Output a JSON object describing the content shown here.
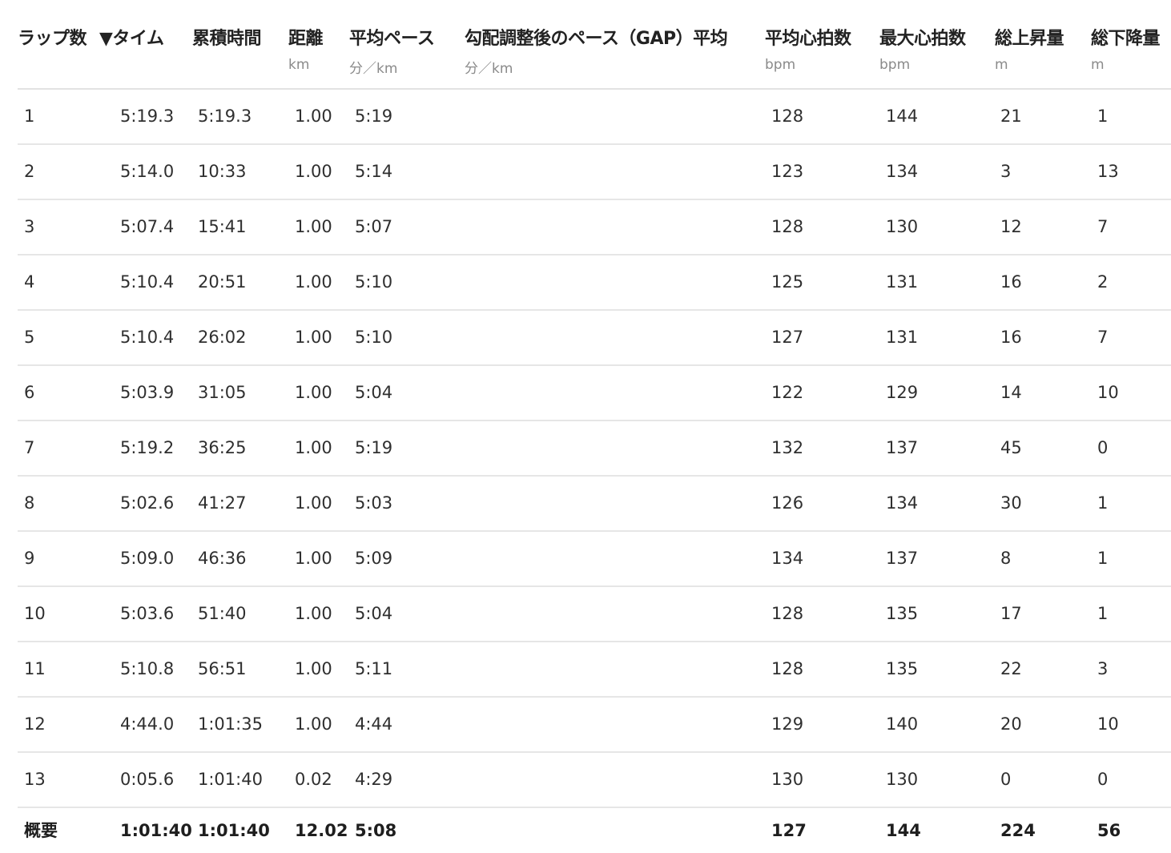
{
  "columns": [
    {
      "key": "lap",
      "title": "ラップ数",
      "unit": ""
    },
    {
      "key": "time",
      "title": "▼タイム",
      "unit": ""
    },
    {
      "key": "cumulative",
      "title": "累積時間",
      "unit": ""
    },
    {
      "key": "distance",
      "title": "距離",
      "unit": "km"
    },
    {
      "key": "pace",
      "title": "平均ペース",
      "unit": "分／km"
    },
    {
      "key": "gap",
      "title": "勾配調整後のペース（GAP）平均",
      "unit": "分／km"
    },
    {
      "key": "avg_hr",
      "title": "平均心拍数",
      "unit": "bpm"
    },
    {
      "key": "max_hr",
      "title": "最大心拍数",
      "unit": "bpm"
    },
    {
      "key": "ascent",
      "title": "総上昇量",
      "unit": "m"
    },
    {
      "key": "descent",
      "title": "総下降量",
      "unit": "m"
    }
  ],
  "rows": [
    [
      "1",
      "5:19.3",
      "5:19.3",
      "1.00",
      "5:19",
      "",
      "128",
      "144",
      "21",
      "1"
    ],
    [
      "2",
      "5:14.0",
      "10:33",
      "1.00",
      "5:14",
      "",
      "123",
      "134",
      "3",
      "13"
    ],
    [
      "3",
      "5:07.4",
      "15:41",
      "1.00",
      "5:07",
      "",
      "128",
      "130",
      "12",
      "7"
    ],
    [
      "4",
      "5:10.4",
      "20:51",
      "1.00",
      "5:10",
      "",
      "125",
      "131",
      "16",
      "2"
    ],
    [
      "5",
      "5:10.4",
      "26:02",
      "1.00",
      "5:10",
      "",
      "127",
      "131",
      "16",
      "7"
    ],
    [
      "6",
      "5:03.9",
      "31:05",
      "1.00",
      "5:04",
      "",
      "122",
      "129",
      "14",
      "10"
    ],
    [
      "7",
      "5:19.2",
      "36:25",
      "1.00",
      "5:19",
      "",
      "132",
      "137",
      "45",
      "0"
    ],
    [
      "8",
      "5:02.6",
      "41:27",
      "1.00",
      "5:03",
      "",
      "126",
      "134",
      "30",
      "1"
    ],
    [
      "9",
      "5:09.0",
      "46:36",
      "1.00",
      "5:09",
      "",
      "134",
      "137",
      "8",
      "1"
    ],
    [
      "10",
      "5:03.6",
      "51:40",
      "1.00",
      "5:04",
      "",
      "128",
      "135",
      "17",
      "1"
    ],
    [
      "11",
      "5:10.8",
      "56:51",
      "1.00",
      "5:11",
      "",
      "128",
      "135",
      "22",
      "3"
    ],
    [
      "12",
      "4:44.0",
      "1:01:35",
      "1.00",
      "4:44",
      "",
      "129",
      "140",
      "20",
      "10"
    ],
    [
      "13",
      "0:05.6",
      "1:01:40",
      "0.02",
      "4:29",
      "",
      "130",
      "130",
      "0",
      "0"
    ]
  ],
  "summary": [
    "概要",
    "1:01:40",
    "1:01:40",
    "12.02",
    "5:08",
    "",
    "127",
    "144",
    "224",
    "56"
  ]
}
